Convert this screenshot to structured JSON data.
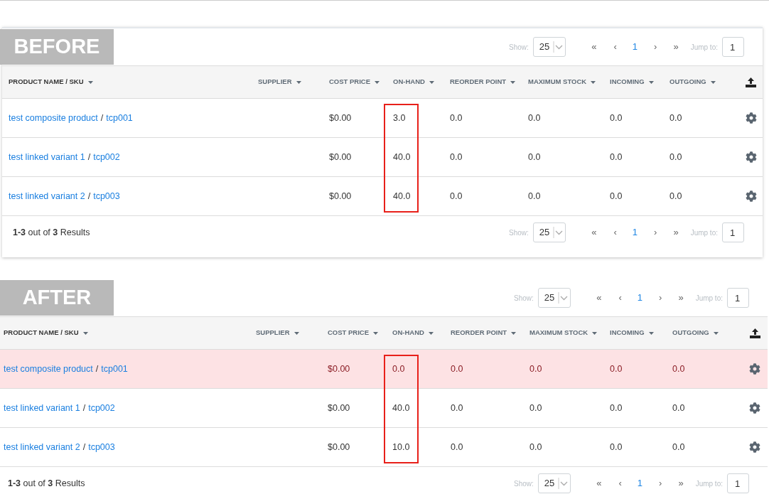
{
  "panels": [
    {
      "label": "BEFORE",
      "pager_top": {
        "show_label": "Show:",
        "page_size": "25",
        "first": "«",
        "prev": "‹",
        "page": "1",
        "next": "›",
        "last": "»",
        "jump_label": "Jump to:",
        "jump_value": "1"
      },
      "columns": [
        "PRODUCT NAME / SKU",
        "SUPPLIER",
        "COST PRICE",
        "ON-HAND",
        "REORDER POINT",
        "MAXIMUM STOCK",
        "INCOMING",
        "OUTGOING"
      ],
      "onhand_framed": true,
      "rows": [
        {
          "alert": false,
          "cells": [
            {
              "name": "test composite product",
              "separator": "/",
              "sku": "tcp001"
            },
            "",
            "$0.00",
            "3.0",
            "0.0",
            "0.0",
            "0.0",
            "0.0"
          ]
        },
        {
          "alert": false,
          "cells": [
            {
              "name": "test linked variant 1",
              "separator": "/",
              "sku": "tcp002"
            },
            "",
            "$0.00",
            "40.0",
            "0.0",
            "0.0",
            "0.0",
            "0.0"
          ]
        },
        {
          "alert": false,
          "cells": [
            {
              "name": "test linked variant 2",
              "separator": "/",
              "sku": "tcp003"
            },
            "",
            "$0.00",
            "40.0",
            "0.0",
            "0.0",
            "0.0",
            "0.0"
          ]
        }
      ],
      "footer": {
        "results": "**1-3** out of **3** Results",
        "pager": {
          "show_label": "Show:",
          "page_size": "25",
          "first": "«",
          "prev": "‹",
          "page": "1",
          "next": "›",
          "last": "»",
          "jump_label": "Jump to:",
          "jump_value": "1"
        }
      }
    },
    {
      "label": "AFTER",
      "pager_top": {
        "show_label": "Show:",
        "page_size": "25",
        "first": "«",
        "prev": "‹",
        "page": "1",
        "next": "›",
        "last": "»",
        "jump_label": "Jump to:",
        "jump_value": "1"
      },
      "columns": [
        "PRODUCT NAME / SKU",
        "SUPPLIER",
        "COST PRICE",
        "ON-HAND",
        "REORDER POINT",
        "MAXIMUM STOCK",
        "INCOMING",
        "OUTGOING"
      ],
      "onhand_framed": true,
      "rows": [
        {
          "alert": true,
          "cells": [
            {
              "name": "test composite product",
              "separator": "/",
              "sku": "tcp001"
            },
            "",
            "$0.00",
            "0.0",
            "0.0",
            "0.0",
            "0.0",
            "0.0"
          ]
        },
        {
          "alert": false,
          "cells": [
            {
              "name": "test linked variant 1",
              "separator": "/",
              "sku": "tcp002"
            },
            "",
            "$0.00",
            "40.0",
            "0.0",
            "0.0",
            "0.0",
            "0.0"
          ]
        },
        {
          "alert": false,
          "cells": [
            {
              "name": "test linked variant 2",
              "separator": "/",
              "sku": "tcp003"
            },
            "",
            "$0.00",
            "10.0",
            "0.0",
            "0.0",
            "0.0",
            "0.0"
          ]
        }
      ],
      "footer": {
        "results": "**1-3** out of **3** Results",
        "pager": {
          "show_label": "Show:",
          "page_size": "25",
          "first": "«",
          "prev": "‹",
          "page": "1",
          "next": "›",
          "last": "»",
          "jump_label": "Jump to:",
          "jump_value": "1"
        }
      }
    }
  ]
}
